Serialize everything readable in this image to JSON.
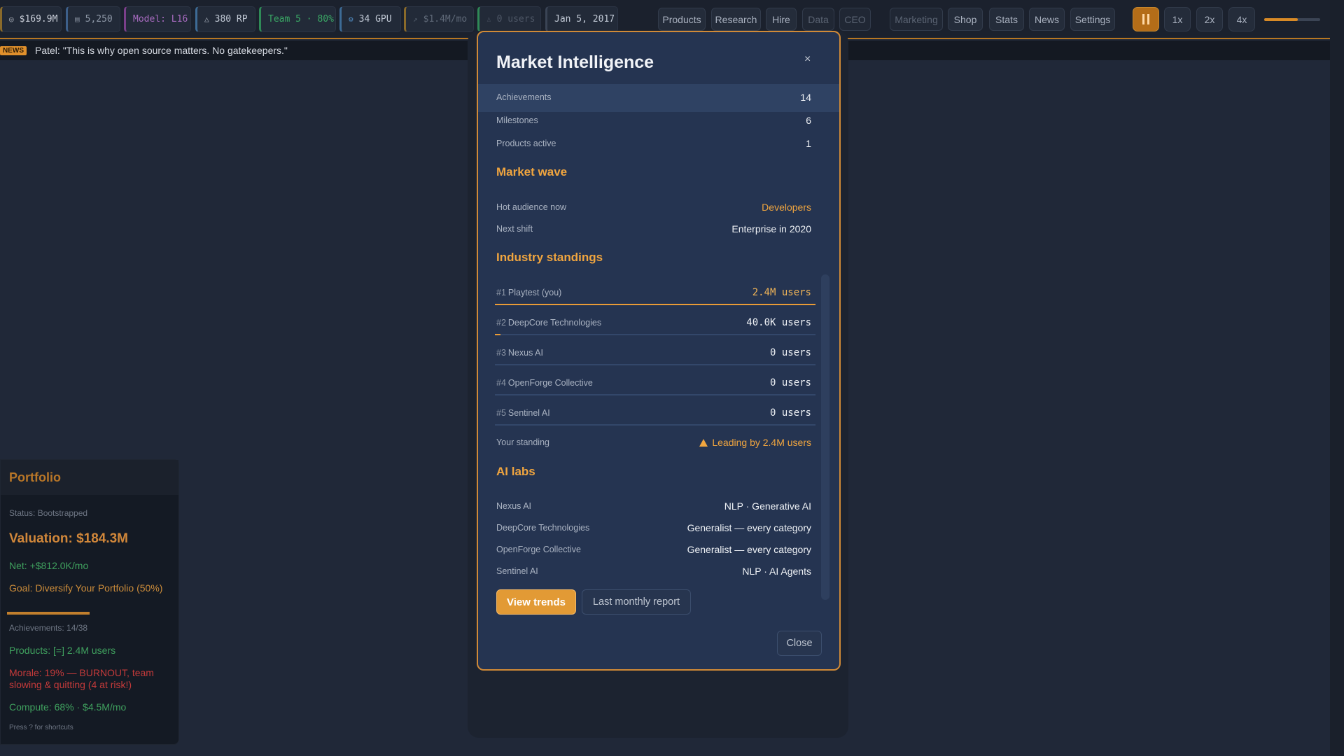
{
  "topbar": {
    "stats": [
      {
        "icon": "coin-icon",
        "glyph": "◎",
        "value": "$169.9M"
      },
      {
        "icon": "calendar-icon",
        "glyph": "▤",
        "value": "5,250"
      },
      {
        "icon": "model-icon",
        "glyph": "",
        "value": "Model: L16"
      },
      {
        "icon": "research-icon",
        "glyph": "△",
        "value": "380 RP"
      },
      {
        "icon": "team-icon",
        "glyph": "",
        "value": "Team 5 · 80%"
      },
      {
        "icon": "gpu-icon",
        "glyph": "⚙",
        "value": "34 GPU"
      },
      {
        "icon": "trend-icon",
        "glyph": "↗",
        "value": "$1.4M/mo"
      },
      {
        "icon": "users-icon",
        "glyph": "♙",
        "value": "0 users"
      },
      {
        "icon": "date-icon",
        "glyph": "",
        "value": "Jan 5, 2017"
      }
    ],
    "nav": [
      "Products",
      "Research",
      "Hire",
      "Data",
      "CEO",
      "Marketing",
      "Shop",
      "Stats",
      "News",
      "Settings"
    ],
    "speeds": [
      "1x",
      "2x",
      "4x"
    ],
    "volume": 0.6,
    "colors": {
      "accent": "#d88a26",
      "border": "#b87722"
    }
  },
  "news": {
    "tag": "NEWS",
    "text": "Patel: \"This is why open source matters. No gatekeepers.\""
  },
  "portfolio": {
    "title": "Portfolio",
    "status": "Status: Bootstrapped",
    "valuation": "Valuation: $184.3M",
    "net": "Net: +$812.0K/mo",
    "goal": "Goal: Diversify Your Portfolio (50%)",
    "goal_progress": 0.5,
    "achievements": "Achievements: 14/38",
    "products": "Products: [=] 2.4M users",
    "morale": "Morale: 19% — BURNOUT, team slowing & quitting (4 at risk!)",
    "compute": "Compute: 68% · $4.5M/mo",
    "hint": "Press ? for shortcuts"
  },
  "modal": {
    "title": "Market Intelligence",
    "close_x": "×",
    "summary": [
      {
        "label": "Achievements",
        "value": "14"
      },
      {
        "label": "Milestones",
        "value": "6"
      },
      {
        "label": "Products active",
        "value": "1"
      }
    ],
    "market_wave": {
      "heading": "Market wave",
      "hot_label": "Hot audience now",
      "hot_value": "Developers",
      "next_label": "Next shift",
      "next_value": "Enterprise in 2020"
    },
    "standings": {
      "heading": "Industry standings",
      "rows": [
        {
          "rank": "#1",
          "name": "Playtest (you)",
          "users": "2.4M users",
          "share": 1.0,
          "me": true
        },
        {
          "rank": "#2",
          "name": "DeepCore Technologies",
          "users": "40.0K users",
          "share": 0.017,
          "me": false
        },
        {
          "rank": "#3",
          "name": "Nexus AI",
          "users": "0 users",
          "share": 0,
          "me": false
        },
        {
          "rank": "#4",
          "name": "OpenForge Collective",
          "users": "0 users",
          "share": 0,
          "me": false
        },
        {
          "rank": "#5",
          "name": "Sentinel AI",
          "users": "0 users",
          "share": 0,
          "me": false
        }
      ],
      "standing_label": "Your standing",
      "standing_value": "Leading by 2.4M users"
    },
    "labs": {
      "heading": "AI labs",
      "rows": [
        {
          "name": "Nexus AI",
          "focus": "NLP · Generative AI"
        },
        {
          "name": "DeepCore Technologies",
          "focus": "Generalist — every category"
        },
        {
          "name": "OpenForge Collective",
          "focus": "Generalist — every category"
        },
        {
          "name": "Sentinel AI",
          "focus": "NLP · AI Agents"
        }
      ]
    },
    "buttons": {
      "trends": "View trends",
      "report": "Last monthly report",
      "close": "Close"
    }
  }
}
